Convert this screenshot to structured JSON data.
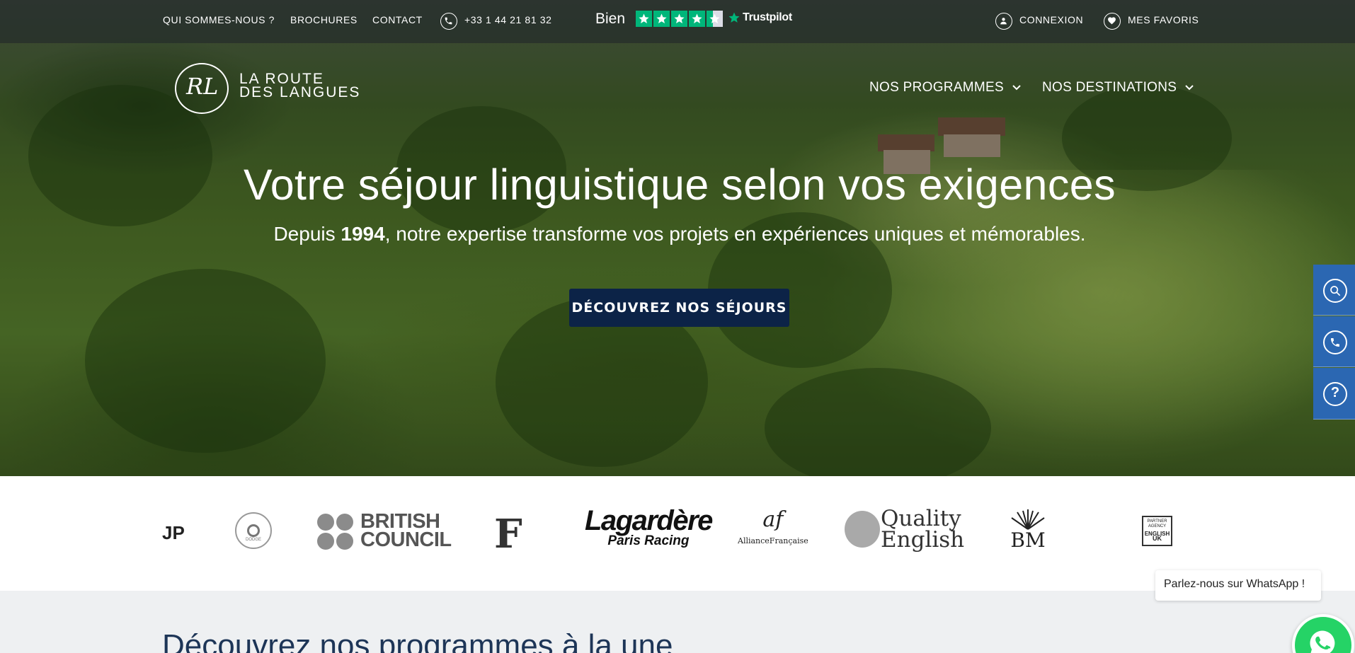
{
  "topbar": {
    "links": [
      "QUI SOMMES-NOUS ?",
      "BROCHURES",
      "CONTACT"
    ],
    "phone": "+33 1 44 21 81 32",
    "trustpilot": {
      "rating_label": "Bien",
      "brand": "Trustpilot",
      "stars": 4.5,
      "star_color": "#00b67a"
    },
    "login": "CONNEXION",
    "favorites": "MES FAVORIS"
  },
  "brand": {
    "monogram": "RL",
    "line1": "LA ROUTE",
    "line2": "DES LANGUES"
  },
  "nav": {
    "programs": "NOS PROGRAMMES",
    "destinations": "NOS DESTINATIONS"
  },
  "hero": {
    "title": "Votre séjour linguistique selon vos exigences",
    "subtitle_pre": "Depuis ",
    "subtitle_year": "1994",
    "subtitle_post": ", notre expertise transforme vos projets en expériences uniques et mémorables.",
    "cta": "DÉCOUVREZ NOS SÉJOURS"
  },
  "side_widgets": [
    "search-icon",
    "phone-icon",
    "help-icon"
  ],
  "partners": {
    "first": "JP",
    "second": "DODGE",
    "british_council": [
      "BRITISH",
      "COUNCIL"
    ],
    "figaro": "F",
    "lagardere": [
      "Lagardère",
      "Paris Racing"
    ],
    "alliance": [
      "af",
      "AllianceFrançaise"
    ],
    "quality": [
      "Quality",
      "English"
    ],
    "bm": "BM",
    "english_uk": [
      "PARTNER",
      "AGENCY",
      "ENGLISH",
      "UK"
    ]
  },
  "section": {
    "title": "Découvrez nos programmes à la une"
  },
  "whatsapp": {
    "label": "Parlez-nous sur WhatsApp !"
  },
  "colors": {
    "cta": "#0c2347",
    "side": "#2b67b2",
    "whatsapp": "#25d366",
    "section_title": "#1d3557"
  }
}
